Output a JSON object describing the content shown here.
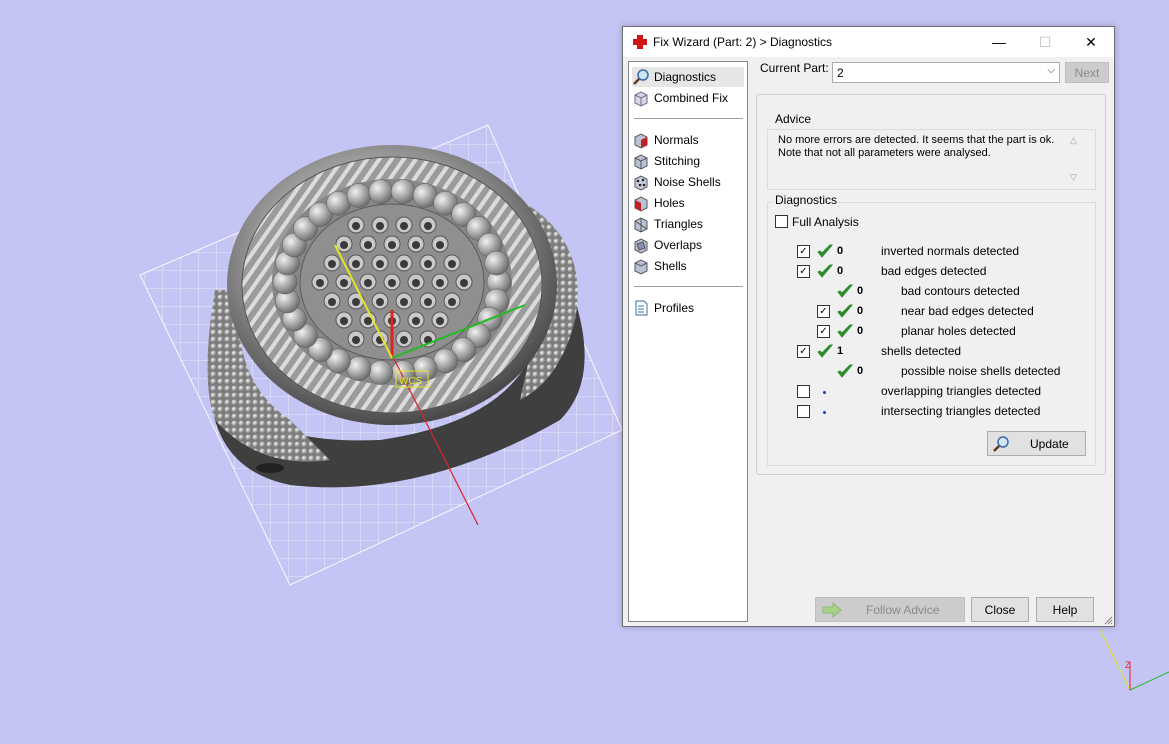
{
  "window": {
    "title": "Fix Wizard (Part: 2) > Diagnostics",
    "minimize_symbol": "—",
    "maximize_symbol": "☐",
    "close_symbol": "✕"
  },
  "nav": {
    "items": [
      {
        "label": "Diagnostics",
        "icon": "magnifier-icon"
      },
      {
        "label": "Combined Fix",
        "icon": "combined-fix-icon"
      },
      {
        "label": "Normals",
        "icon": "normals-cube-icon"
      },
      {
        "label": "Stitching",
        "icon": "stitching-cube-icon"
      },
      {
        "label": "Noise Shells",
        "icon": "noise-shells-icon"
      },
      {
        "label": "Holes",
        "icon": "holes-cube-icon"
      },
      {
        "label": "Triangles",
        "icon": "triangles-cube-icon"
      },
      {
        "label": "Overlaps",
        "icon": "overlaps-cube-icon"
      },
      {
        "label": "Shells",
        "icon": "shells-cube-icon"
      },
      {
        "label": "Profiles",
        "icon": "profiles-doc-icon"
      }
    ],
    "selected": "Diagnostics"
  },
  "current_part": {
    "label": "Current Part:",
    "value": "2",
    "next_label": "Next"
  },
  "advice": {
    "title": "Advice",
    "text": "No more errors are detected. It seems that the part is ok. Note that not all parameters were analysed."
  },
  "diagnostics": {
    "title": "Diagnostics",
    "full_analysis_label": "Full Analysis",
    "full_analysis_checked": false,
    "rows": [
      {
        "has_checkbox": true,
        "checked": true,
        "status": "ok",
        "count": "0",
        "label": "inverted normals detected",
        "indent": 0
      },
      {
        "has_checkbox": true,
        "checked": true,
        "status": "ok",
        "count": "0",
        "label": "bad edges detected",
        "indent": 0
      },
      {
        "has_checkbox": false,
        "checked": false,
        "status": "ok",
        "count": "0",
        "label": "bad contours detected",
        "indent": 1
      },
      {
        "has_checkbox": true,
        "checked": true,
        "status": "ok",
        "count": "0",
        "label": "near bad edges detected",
        "indent": 1
      },
      {
        "has_checkbox": true,
        "checked": true,
        "status": "ok",
        "count": "0",
        "label": "planar holes detected",
        "indent": 1
      },
      {
        "has_checkbox": true,
        "checked": true,
        "status": "ok",
        "count": "1",
        "label": "shells detected",
        "indent": 0
      },
      {
        "has_checkbox": false,
        "checked": false,
        "status": "ok",
        "count": "0",
        "label": "possible noise shells detected",
        "indent": 1
      },
      {
        "has_checkbox": true,
        "checked": false,
        "status": "pending",
        "count": "",
        "label": "overlapping triangles detected",
        "indent": 0
      },
      {
        "has_checkbox": true,
        "checked": false,
        "status": "pending",
        "count": "",
        "label": "intersecting triangles detected",
        "indent": 0
      }
    ],
    "update_label": "Update"
  },
  "buttons": {
    "follow_advice": "Follow Advice",
    "close": "Close",
    "help": "Help"
  },
  "viewport": {
    "wcs_label": "WCS",
    "background_color": "#c5c5f5"
  },
  "colors": {
    "check_green": "#2e8b2e",
    "axis_x": "#dd2222",
    "axis_y": "#22bb22",
    "axis_z": "#dddd22"
  }
}
